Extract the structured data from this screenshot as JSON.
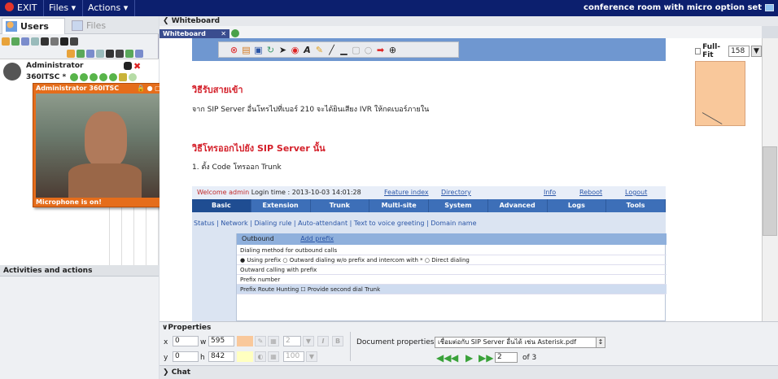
{
  "topbar": {
    "exit_label": "EXIT",
    "files_label": "Files",
    "actions_label": "Actions",
    "room_title": "conference room with micro option set"
  },
  "left": {
    "tab_users": "Users",
    "tab_files": "Files",
    "admin_name": "Administrator",
    "admin_sub": "360ITSC *",
    "video_title": "Administrator 360ITSC",
    "video_status": "Microphone is on!",
    "activities_title": "Activities and actions"
  },
  "whiteboard": {
    "header": "Whiteboard",
    "tab_label": "Whiteboard",
    "tab_close": "✕",
    "fullfit_label": "Full-Fit",
    "zoom_value": "158",
    "heading1": "วิธีรับสายเข้า",
    "para1": "จาก SIP Server อื่นโทรไปที่เบอร์ 210 จะได้ยินเสียง IVR ให้กดเบอร์ภายใน",
    "heading2": "วิธีโทรออกไปยัง SIP Server นั้น",
    "para2": "1. ตั้ง Code โทรออก Trunk",
    "shot": {
      "welcome": "Welcome admin",
      "login_time": "Login time : 2013-10-03 14:01:28",
      "feature_index": "Feature index",
      "directory": "Directory",
      "info": "Info",
      "reboot": "Reboot",
      "logout": "Logout",
      "nav": [
        "Basic",
        "Extension",
        "Trunk",
        "Multi-site",
        "System",
        "Advanced",
        "Logs",
        "Tools"
      ],
      "subnav": "Status | Network | Dialing rule | Auto-attendant | Text to voice greeting | Domain name",
      "panel_title": "Outbound",
      "add_prefix": "Add prefix",
      "dial_method": "Dialing method for outbound calls",
      "options": "● Using prefix    ○ Outward dialing w/o prefix and intercom with *    ○ Direct dialing",
      "outward": "Outward calling with prefix",
      "prefix_number": "Prefix number",
      "cols": "Prefix          Route             Hunting                    ☐ Provide second dial        Trunk"
    }
  },
  "properties": {
    "title": "Properties",
    "x_label": "x",
    "x_value": "0",
    "y_label": "y",
    "y_value": "0",
    "w_label": "w",
    "w_value": "595",
    "h_label": "h",
    "h_value": "842",
    "line_width": "2",
    "opacity": "100",
    "doc_props_label": "Document properties",
    "doc_file": "เชื่อมต่อกับ SIP Server อื่นได้ เช่น Asterisk.pdf",
    "page_value": "2",
    "page_of": "of 3",
    "swatch_color": "#f9c89b",
    "swatch2_color": "#ffffc0"
  },
  "chat": {
    "title": "Chat"
  }
}
